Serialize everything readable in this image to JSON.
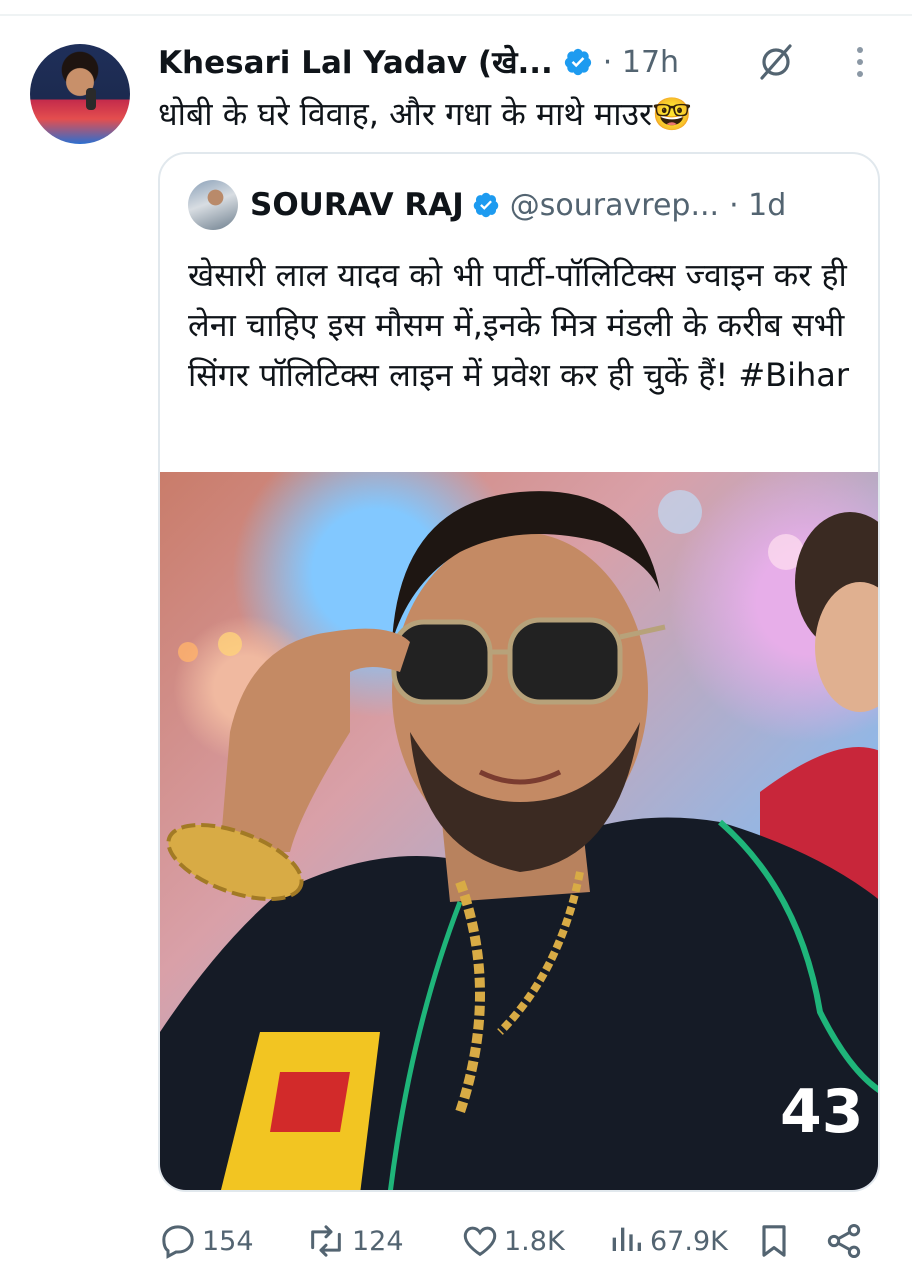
{
  "tweet": {
    "author_name": "Khesari Lal Yadav (खे...",
    "time": "· 17h",
    "text": "धोबी के घरे विवाह, और गधा के माथे माउर🤓"
  },
  "quoted_tweet": {
    "author_name": "SOURAV RAJ",
    "handle": "@souravrep...",
    "time": "· 1d",
    "text": "खेसारी लाल यादव को भी पार्टी-पॉलिटिक्स ज्वाइन कर ही लेना चाहिए इस मौसम में,इनके मित्र मंडली के करीब सभी सिंगर पॉलिटिक्स लाइन में प्रवेश कर ही चुकें हैं!",
    "hashtag": "#Bihar",
    "image_jersey_number": "43"
  },
  "actions": {
    "replies": "154",
    "reposts": "124",
    "likes": "1.8K",
    "views": "67.9K"
  },
  "icons": {
    "verified": "verified-badge-icon",
    "grok": "grok-icon",
    "more": "more-vertical-icon",
    "reply": "reply-icon",
    "repost": "repost-icon",
    "like": "heart-icon",
    "views": "views-icon",
    "bookmark": "bookmark-icon",
    "share": "share-icon"
  },
  "colors": {
    "text": "#0f1419",
    "muted": "#536471",
    "verified": "#1d9bf0",
    "border": "#e1e8ed"
  }
}
